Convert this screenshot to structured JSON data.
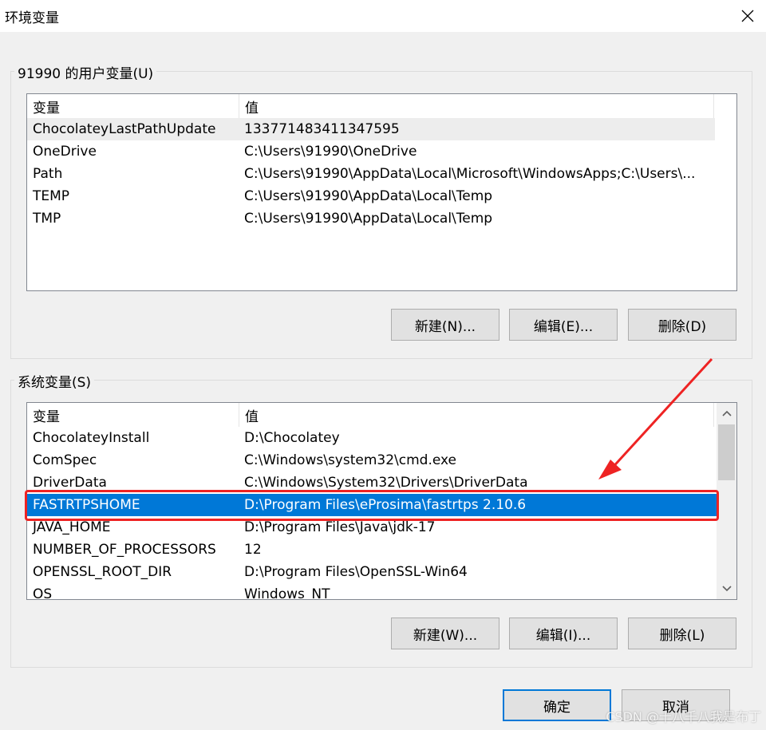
{
  "window": {
    "title": "环境变量"
  },
  "user_vars": {
    "group_label": "91990 的用户变量(U)",
    "columns": {
      "name": "变量",
      "value": "值"
    },
    "rows": [
      {
        "name": "ChocolateyLastPathUpdate",
        "value": "133771483411347595"
      },
      {
        "name": "OneDrive",
        "value": "C:\\Users\\91990\\OneDrive"
      },
      {
        "name": "Path",
        "value": "C:\\Users\\91990\\AppData\\Local\\Microsoft\\WindowsApps;C:\\Users\\..."
      },
      {
        "name": "TEMP",
        "value": "C:\\Users\\91990\\AppData\\Local\\Temp"
      },
      {
        "name": "TMP",
        "value": "C:\\Users\\91990\\AppData\\Local\\Temp"
      }
    ],
    "buttons": {
      "new": "新建(N)...",
      "edit": "编辑(E)...",
      "delete": "删除(D)"
    }
  },
  "system_vars": {
    "group_label": "系统变量(S)",
    "columns": {
      "name": "变量",
      "value": "值"
    },
    "rows": [
      {
        "name": "ChocolateyInstall",
        "value": "D:\\Chocolatey"
      },
      {
        "name": "ComSpec",
        "value": "C:\\Windows\\system32\\cmd.exe"
      },
      {
        "name": "DriverData",
        "value": "C:\\Windows\\System32\\Drivers\\DriverData"
      },
      {
        "name": "FASTRTPSHOME",
        "value": "D:\\Program Files\\eProsima\\fastrtps 2.10.6"
      },
      {
        "name": "JAVA_HOME",
        "value": "D:\\Program Files\\Java\\jdk-17"
      },
      {
        "name": "NUMBER_OF_PROCESSORS",
        "value": "12"
      },
      {
        "name": "OPENSSL_ROOT_DIR",
        "value": "D:\\Program Files\\OpenSSL-Win64"
      },
      {
        "name": "OS",
        "value": "Windows_NT"
      }
    ],
    "selected_row": "FASTRTPSHOME",
    "buttons": {
      "new": "新建(W)...",
      "edit": "编辑(I)...",
      "delete": "删除(L)"
    }
  },
  "footer": {
    "ok": "确定",
    "cancel": "取消"
  },
  "watermark": "CSDN @十八千八我是布丁",
  "colors": {
    "selection": "#0078d7",
    "annotation": "#ee2323"
  }
}
